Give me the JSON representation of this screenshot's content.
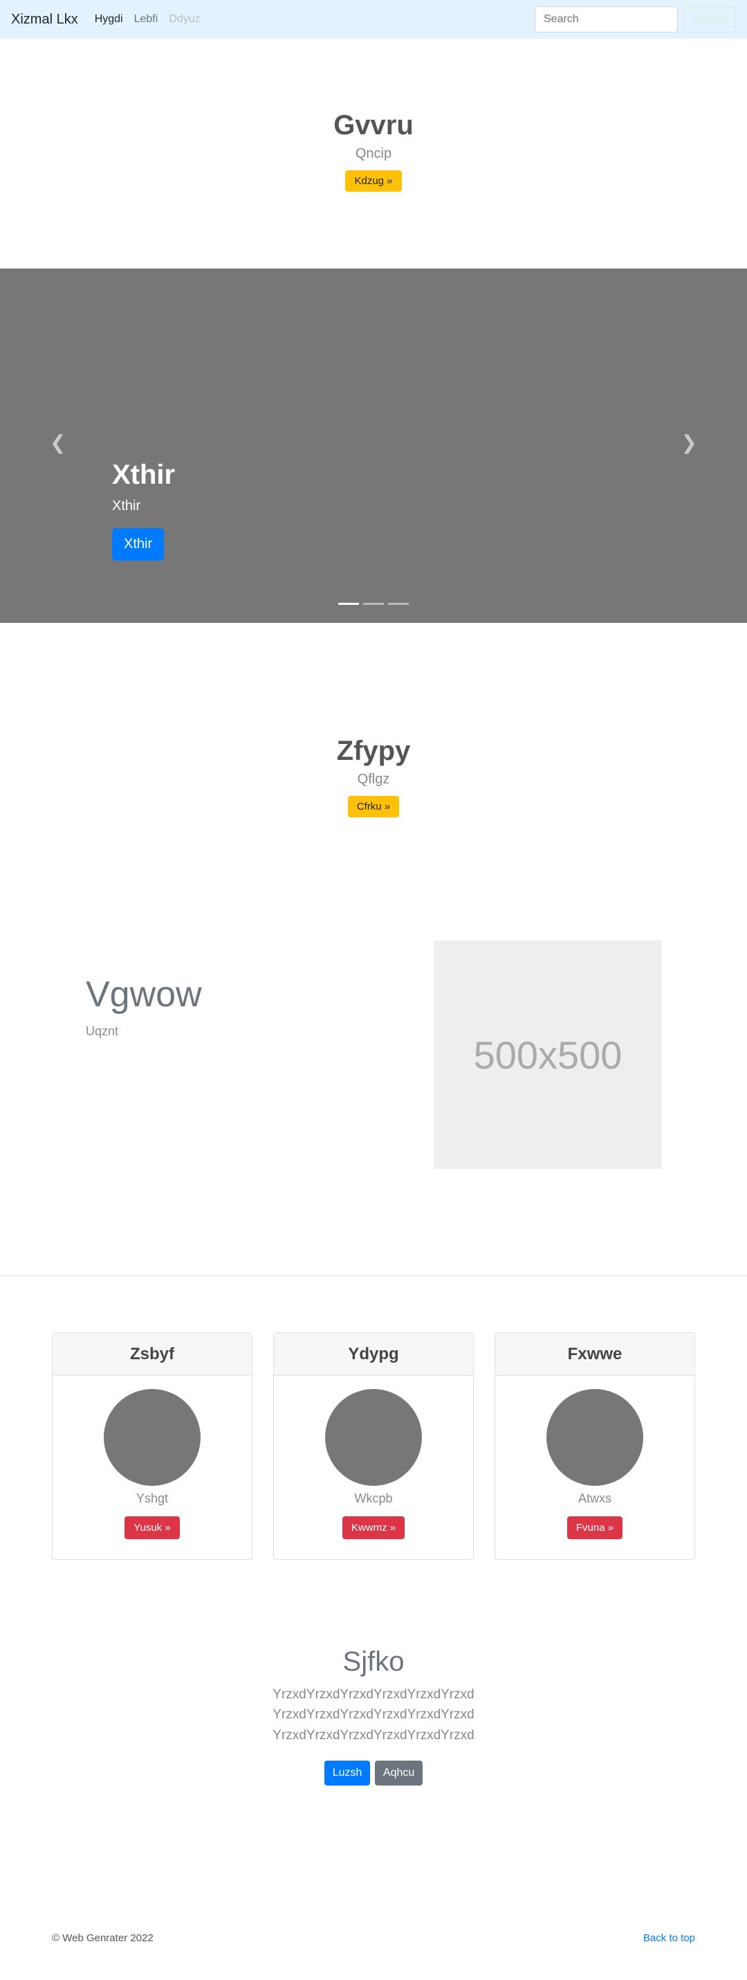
{
  "navbar": {
    "brand": "Xizmal Lkx",
    "links": [
      "Hygdi",
      "Lebfi",
      "Ddyuz"
    ],
    "search_placeholder": "Search",
    "search_button": "Search",
    "bg_color": "#e3f2fd"
  },
  "hero1": {
    "title": "Gvvru",
    "subtitle": "Qncip",
    "button": "Kdzug »"
  },
  "carousel": {
    "title": "Xthir",
    "text": "Xthir",
    "button": "Xthir",
    "prev_icon": "chevron-left-icon",
    "next_icon": "chevron-right-icon",
    "slide_count": 3,
    "active_slide": 1
  },
  "hero2": {
    "title": "Zfypy",
    "subtitle": "Qflgz",
    "button": "Cfrku »"
  },
  "feature": {
    "title": "Vgwow",
    "subtitle": "Uqznt",
    "image_label": "500x500"
  },
  "cards": [
    {
      "header": "Zsbyf",
      "text": "Yshgt",
      "button": "Yusuk »"
    },
    {
      "header": "Ydypg",
      "text": "Wkcpb",
      "button": "Kwwmz »"
    },
    {
      "header": "Fxwwe",
      "text": "Atwxs",
      "button": "Fvuna »"
    }
  ],
  "jumbotron": {
    "title": "Sjfko",
    "text": "YrzxdYrzxdYrzxdYrzxdYrzxdYrzxd YrzxdYrzxdYrzxdYrzxdYrzxdYrzxd YrzxdYrzxdYrzxdYrzxdYrzxdYrzxd",
    "primary_button": "Luzsh",
    "secondary_button": "Aqhcu"
  },
  "footer": {
    "copyright": "© Web Genrater 2022",
    "back_to_top": "Back to top"
  }
}
